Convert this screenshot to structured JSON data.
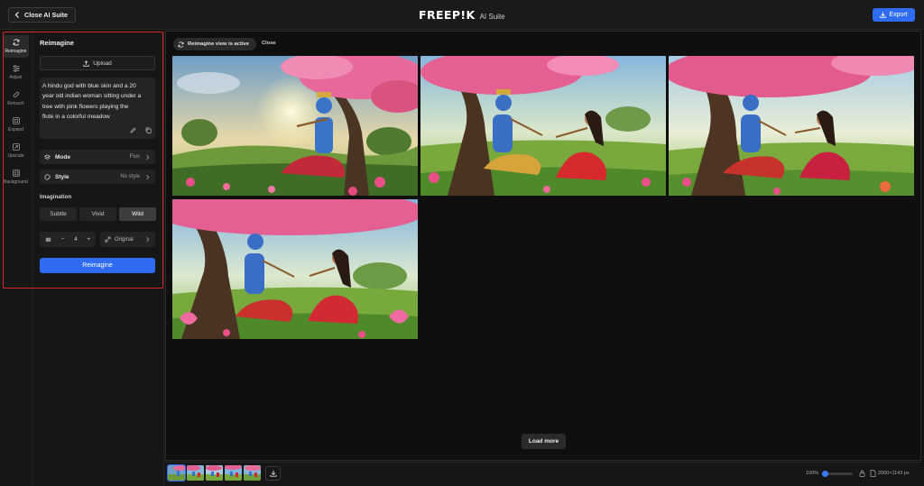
{
  "header": {
    "close_label": "Close AI Suite",
    "logo_text": "FREEP!K",
    "logo_sub": "AI Suite",
    "export_label": "Export"
  },
  "rail": {
    "items": [
      {
        "label": "Reimagine",
        "icon": "refresh-icon"
      },
      {
        "label": "Adjust",
        "icon": "sliders-icon"
      },
      {
        "label": "Retouch",
        "icon": "bandage-icon"
      },
      {
        "label": "Expand",
        "icon": "expand-icon"
      },
      {
        "label": "Upscale",
        "icon": "upscale-icon"
      },
      {
        "label": "Background",
        "icon": "background-icon"
      }
    ],
    "active_index": 0
  },
  "panel": {
    "title": "Reimagine",
    "upload_label": "Upload",
    "prompt_lines": [
      "A  hindu god with  blue skin and a  20",
      "year old  indian  woman sitting under a",
      "tree with  pink flowers playing the",
      "flute in a  colorful meadow"
    ],
    "mode": {
      "label": "Mode",
      "value": "Flux"
    },
    "style": {
      "label": "Style",
      "value": "No style"
    },
    "imagination_label": "Imagination",
    "imagination_options": [
      "Subtle",
      "Vivid",
      "Wild"
    ],
    "imagination_selected": "Wild",
    "count": {
      "minus": "−",
      "value": "4",
      "plus": "+"
    },
    "aspect_value": "Original",
    "reimagine_label": "Reimagine"
  },
  "main": {
    "active_pill": "Reimagine view is active",
    "close_label": "Close",
    "load_more_label": "Load more",
    "image_count": 4
  },
  "bottom": {
    "zoom_label": "100%",
    "zoom_fraction": 0.05,
    "size_label": "2000×1143 px",
    "thumb_count": 5,
    "active_thumb": 0
  },
  "colors": {
    "accent": "#2f6cf2",
    "highlight_border": "#d9262b"
  }
}
